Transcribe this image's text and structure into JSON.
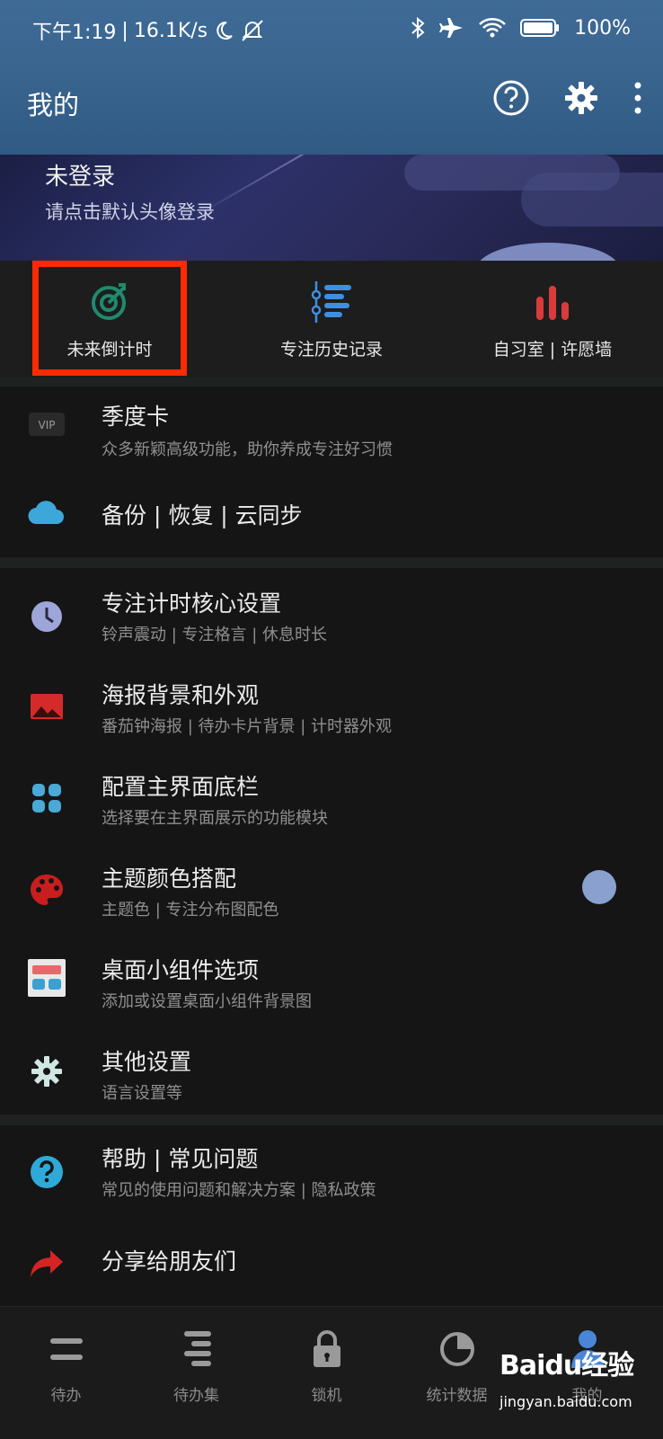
{
  "status_bar": {
    "time": "下午1:19",
    "sep": "|",
    "speed": "16.1K/s",
    "battery": "100%"
  },
  "app_bar": {
    "title": "我的"
  },
  "profile": {
    "title": "未登录",
    "subtitle": "请点击默认头像登录"
  },
  "quick_actions": [
    {
      "label": "未来倒计时",
      "icon": "target-arrow-icon",
      "color": "#1f8a6e"
    },
    {
      "label": "专注历史记录",
      "icon": "timeline-list-icon",
      "color": "#3f8fe0"
    },
    {
      "label": "自习室 | 许愿墙",
      "icon": "bar-chart-icon",
      "color": "#d83b3b"
    }
  ],
  "section1": [
    {
      "title": "季度卡",
      "subtitle": "众多新颖高级功能，助你养成专注好习惯",
      "icon": "vip-icon"
    },
    {
      "title": "备份 | 恢复 | 云同步",
      "subtitle": "",
      "icon": "cloud-icon"
    }
  ],
  "section2": [
    {
      "title": "专注计时核心设置",
      "subtitle": "铃声震动 | 专注格言 | 休息时长",
      "icon": "clock-icon"
    },
    {
      "title": "海报背景和外观",
      "subtitle": "番茄钟海报 | 待办卡片背景 | 计时器外观",
      "icon": "image-icon"
    },
    {
      "title": "配置主界面底栏",
      "subtitle": "选择要在主界面展示的功能模块",
      "icon": "grid-icon"
    },
    {
      "title": "主题颜色搭配",
      "subtitle": "主题色 | 专注分布图配色",
      "icon": "palette-icon"
    },
    {
      "title": "桌面小组件选项",
      "subtitle": "添加或设置桌面小组件背景图",
      "icon": "widget-icon"
    },
    {
      "title": "其他设置",
      "subtitle": "语言设置等",
      "icon": "gear-icon"
    }
  ],
  "section3": [
    {
      "title": "帮助 | 常见问题",
      "subtitle": "常见的使用问题和解决方案 | 隐私政策",
      "icon": "help-icon"
    },
    {
      "title": "分享给朋友们",
      "subtitle": "",
      "icon": "share-icon"
    }
  ],
  "tabs": [
    {
      "label": "待办",
      "icon": "todo-icon"
    },
    {
      "label": "待办集",
      "icon": "todo-set-icon"
    },
    {
      "label": "锁机",
      "icon": "lock-icon"
    },
    {
      "label": "统计数据",
      "icon": "pie-chart-icon"
    },
    {
      "label": "我的",
      "icon": "user-icon"
    }
  ],
  "watermark": {
    "brand": "Baidu经验",
    "url": "jingyan.baidu.com"
  }
}
